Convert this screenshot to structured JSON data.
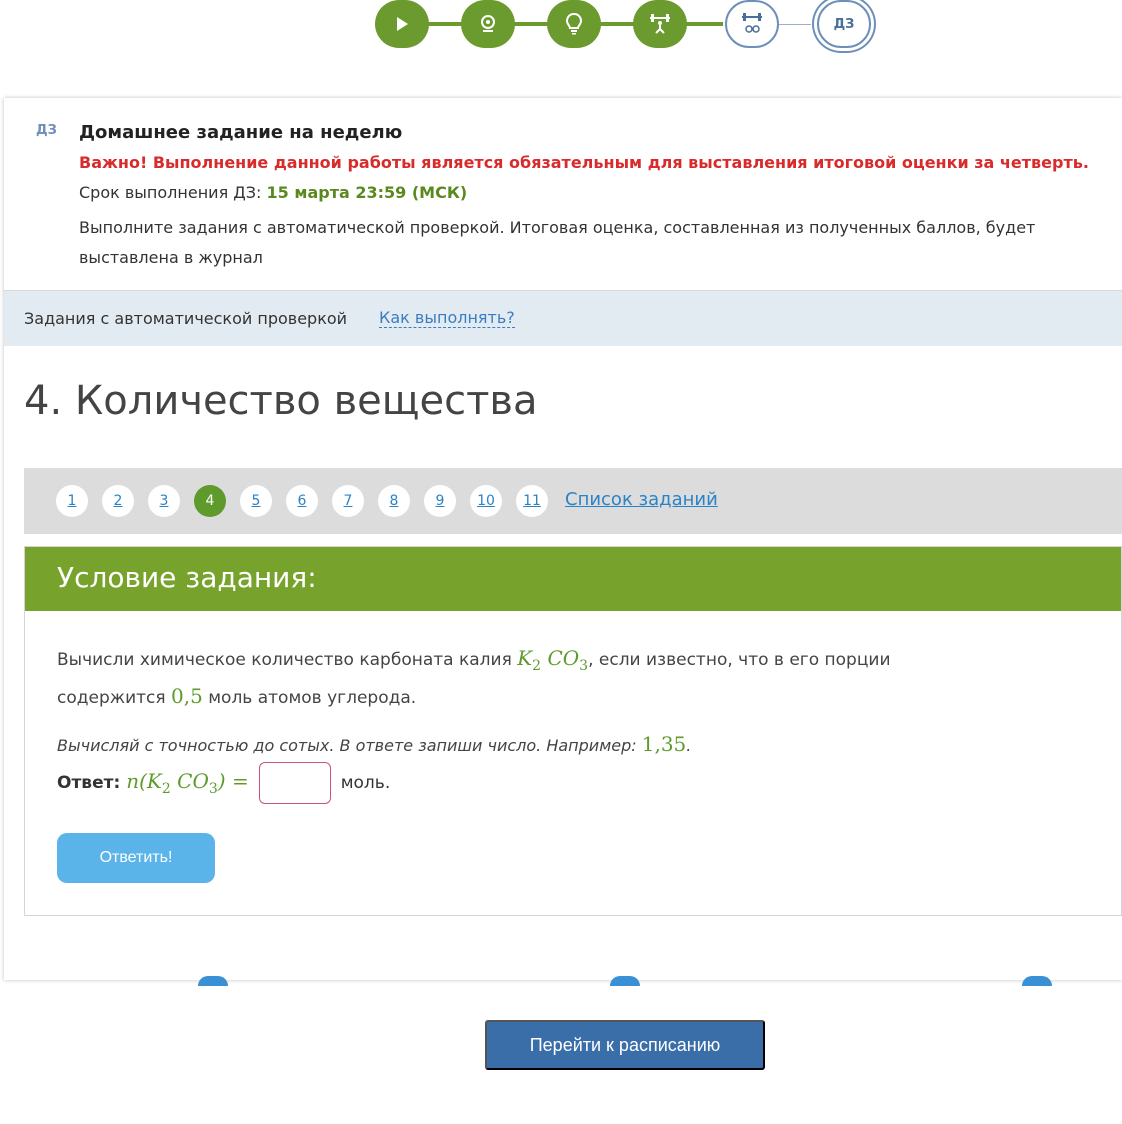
{
  "steps": {
    "current_label": "ДЗ"
  },
  "homework": {
    "tag": "ДЗ",
    "title": "Домашнее задание на неделю",
    "important": "Важно! Выполнение данной работы является обязательным для выставления итоговой оценки за четверть.",
    "deadline_label": "Срок выполнения ДЗ:",
    "deadline_value": "15 марта 23:59 (МСК)",
    "description": "Выполните задания с автоматической проверкой. Итоговая оценка, составленная из полученных баллов, будет выставлена в журнал"
  },
  "auto_bar": {
    "label": "Задания с автоматической проверкой",
    "howto_link": "Как выполнять?"
  },
  "task": {
    "title": "4. Количество вещества"
  },
  "pager": {
    "pages": [
      "1",
      "2",
      "3",
      "4",
      "5",
      "6",
      "7",
      "8",
      "9",
      "10",
      "11"
    ],
    "active": "4",
    "list_link": "Список заданий"
  },
  "condition": {
    "header": "Условие задания:",
    "text_part1": "Вычисли химическое количество карбоната калия",
    "text_part2": ", если известно, что в его порции содержится",
    "text_part3": "моль атомов углерода.",
    "amount": "0,5",
    "hint": "Вычисляй с точностью до сотых. В ответе запиши число. Например:",
    "hint_example": "1,35",
    "answer_label": "Ответ:",
    "answer_unit": "моль.",
    "answer_value": "",
    "submit_label": "Ответить!"
  },
  "footer": {
    "schedule_button": "Перейти к расписанию"
  },
  "colors": {
    "green": "#6b9a2e",
    "red": "#d92b2b",
    "link_blue": "#2a83c7",
    "submit_blue": "#5ab4ea",
    "schedule_blue": "#3a6ea8"
  }
}
